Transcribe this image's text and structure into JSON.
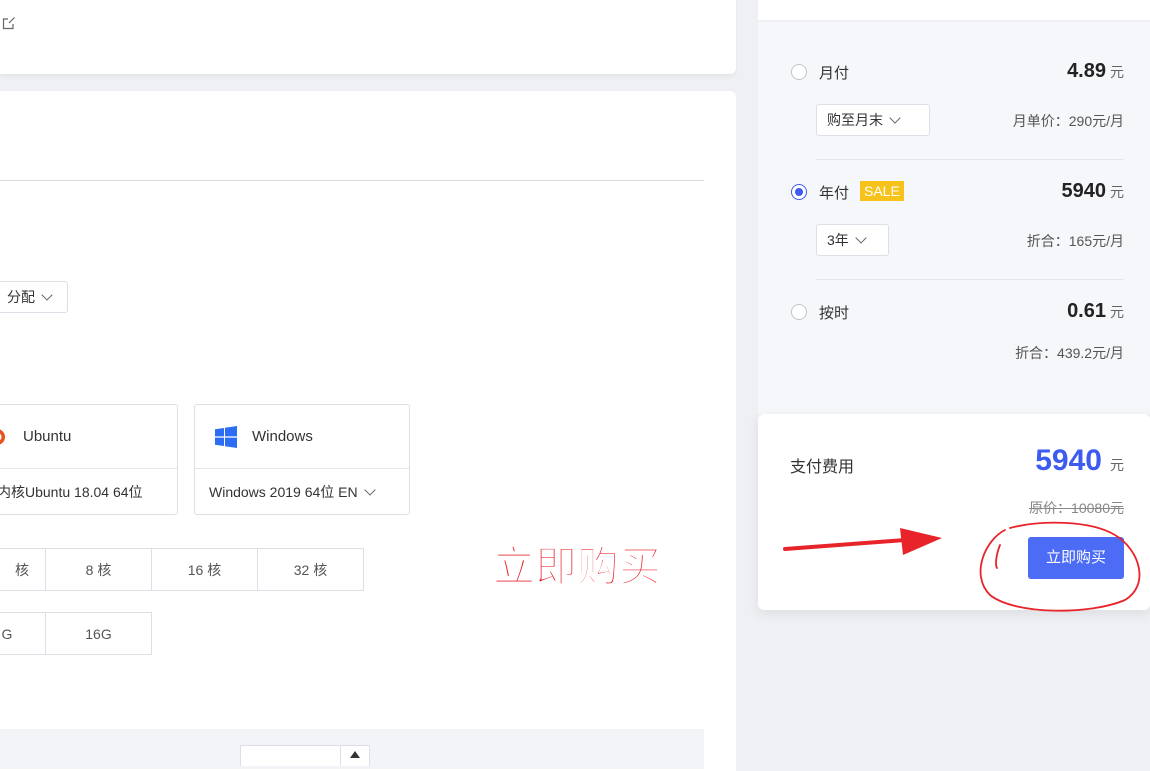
{
  "left": {
    "region_select": "分配",
    "os_options": [
      {
        "name": "Ubuntu",
        "version": "内核Ubuntu 18.04 64位"
      },
      {
        "name": "Windows",
        "version": "Windows 2019 64位 EN"
      }
    ],
    "cpu_options": [
      "核",
      "8 核",
      "16 核",
      "32 核"
    ],
    "mem_options": [
      "G",
      "16G"
    ]
  },
  "annotation": {
    "label": "立即购买",
    "label_color": "#e8232a"
  },
  "billing": {
    "monthly": {
      "label": "月付",
      "price": "4.89",
      "unit": "元",
      "period_select": "购至月末",
      "detail": "月单价：290元/月"
    },
    "yearly": {
      "label": "年付",
      "badge": "SALE",
      "price": "5940",
      "unit": "元",
      "period_select": "3年",
      "detail": "折合：165元/月"
    },
    "hourly": {
      "label": "按时",
      "price": "0.61",
      "unit": "元",
      "detail": "折合：439.2元/月"
    }
  },
  "payment": {
    "label": "支付费用",
    "amount": "5940",
    "unit": "元",
    "original_price": "原价：10080元",
    "buy_button": "立即购买"
  },
  "colors": {
    "accent": "#3d5af1",
    "button": "#4d6cf5",
    "sale_badge": "#f7c21a",
    "annotation_red": "#e8232a"
  }
}
